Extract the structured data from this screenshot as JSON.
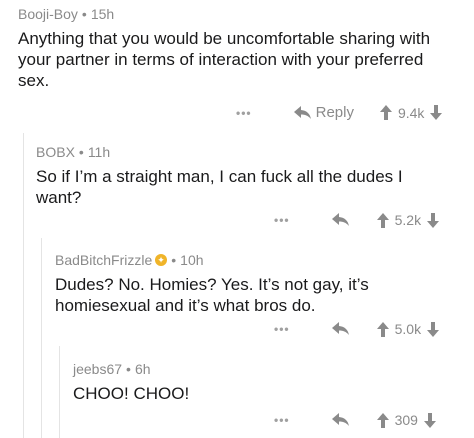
{
  "comments": [
    {
      "author": "Booji-Boy",
      "age": "15h",
      "text": "Anything that you would be uncomfortable sharing with your partner in terms of interaction with your preferred sex.",
      "reply_label": "Reply",
      "score": "9.4k"
    },
    {
      "author": "BOBX",
      "age": "11h",
      "text": "So if I’m a straight man, I can fuck all the dudes I want?",
      "score": "5.2k"
    },
    {
      "author": "BadBitchFrizzle",
      "age": "10h",
      "text": "Dudes? No. Homies? Yes. It’s not gay, it’s homiesexual and it’s what bros do.",
      "score": "5.0k"
    },
    {
      "author": "jeebs67",
      "age": "6h",
      "text": "CHOO! CHOO!",
      "score": "309"
    }
  ],
  "colors": {
    "meta": "#8a8a8a",
    "thread_line": "#e4e4e4",
    "award": "#f0b429"
  },
  "icons": [
    "more-icon",
    "reply-arrow-icon",
    "upvote-icon",
    "downvote-icon",
    "award-icon"
  ],
  "more_label": "•••",
  "separator": "•"
}
